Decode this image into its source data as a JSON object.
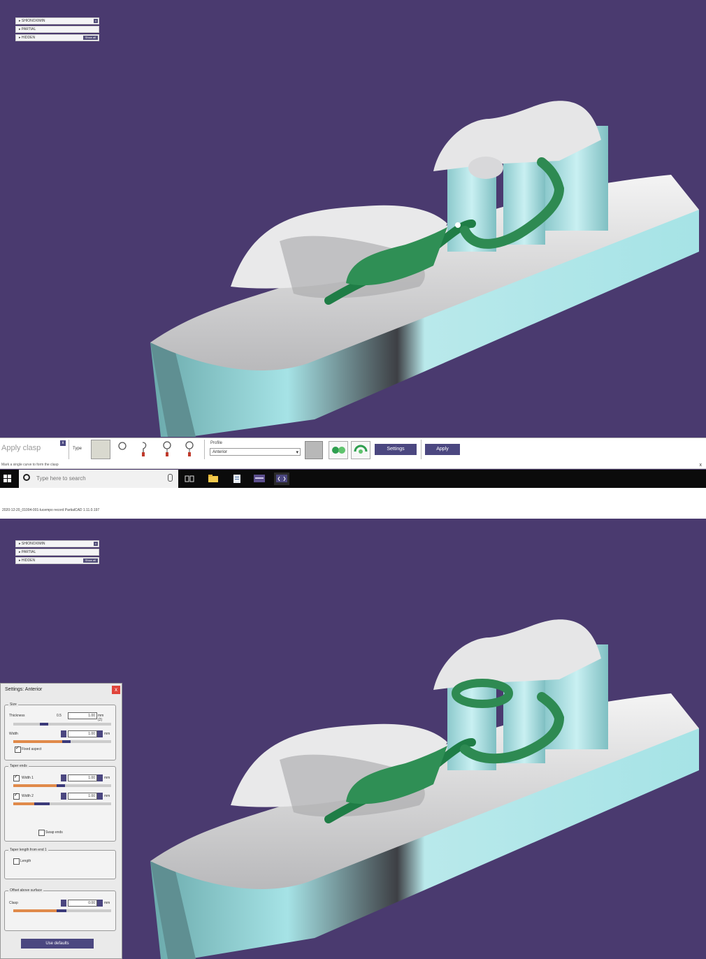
{
  "tree": {
    "rows": [
      "▸ SHIONOXIMIN",
      "▸ PARTIAL",
      "▸ HIDDEN"
    ],
    "show_all_label": "Show all",
    "close_glyph": "x"
  },
  "toolbar": {
    "title": "Apply clasp",
    "close_glyph": "x",
    "type_label": "Type",
    "profile_label": "Profile",
    "profile_value": "Anterior",
    "settings_label": "Settings",
    "apply_label": "Apply",
    "hint": "Mark a single curve to form the clasp",
    "hint_close": "x",
    "icons": [
      "clasp-circle-icon",
      "clasp-hook-icon",
      "clasp-ring-icon",
      "clasp-ring-alt-icon",
      "green-add-icon",
      "green-rotate-icon"
    ]
  },
  "taskbar": {
    "search_placeholder": "Type here to search",
    "apps": [
      "task-view-icon",
      "folder-icon",
      "document-icon",
      "monitor-icon",
      "partial-cad-icon"
    ]
  },
  "status": {
    "text": "2020-12-20_01004-001-lucempo record PartialCAD 1.11.0.197"
  },
  "settings": {
    "title": "Settings: Anterior",
    "close_glyph": "x",
    "size_group": "Size",
    "thickness_label": "Thickness",
    "thickness_value": "1.00",
    "thickness_min": "0.5",
    "thickness_unit": "mm (2)",
    "width_label": "Width",
    "width_value": "1.00",
    "width_unit": "mm",
    "fixed_aspect_label": "Fixed aspect",
    "taper_group": "Taper ends",
    "width1_label": "Width 1",
    "width1_value": "1.00",
    "width1_unit": "mm",
    "width2_label": "Width 2",
    "width2_value": "1.00",
    "width2_unit": "mm",
    "swap_ends_label": "Swap ends",
    "taper_length_group": "Taper length from end 1",
    "length_label": "Length",
    "offset_group": "Offset above surface",
    "clasp_label": "Clasp",
    "clasp_value": "0.00",
    "clasp_unit": "mm",
    "defaults_label": "Use defaults"
  },
  "colors": {
    "viewport_bg": "#4a3a6f",
    "model_green": "#2f8f55",
    "model_cyan": "#a6e3e6",
    "button_purple": "#4b4780",
    "slider_orange": "#e08a4a"
  }
}
